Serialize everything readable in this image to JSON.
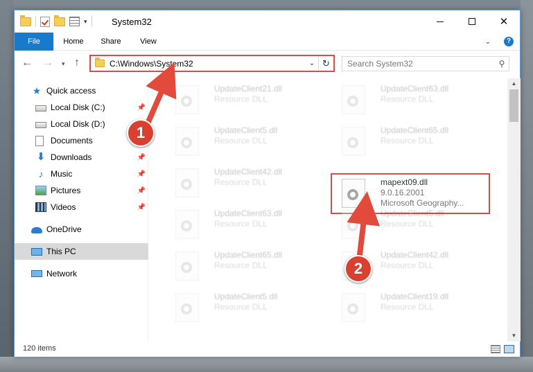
{
  "window": {
    "title": "System32"
  },
  "caption": {
    "minimize_icon": "minimize-icon",
    "maximize_icon": "maximize-icon",
    "close_icon": "close-icon",
    "close_glyph": "✕"
  },
  "ribbon": {
    "tabs": [
      {
        "label": "File",
        "active": true
      },
      {
        "label": "Home"
      },
      {
        "label": "Share"
      },
      {
        "label": "View"
      }
    ],
    "help_glyph": "?"
  },
  "navigation": {
    "back_glyph": "←",
    "forward_glyph": "→",
    "recent_glyph": "▾",
    "up_glyph": "↑",
    "address": "C:\\Windows\\System32",
    "address_dropdown_glyph": "⌄",
    "refresh_glyph": "↻",
    "search_placeholder": "Search System32"
  },
  "sidebar": {
    "items": [
      {
        "label": "Quick access",
        "icon": "star-icon",
        "pinned": false
      },
      {
        "label": "Local Disk (C:)",
        "icon": "disk-icon",
        "pinned": true
      },
      {
        "label": "Local Disk (D:)",
        "icon": "disk-icon",
        "pinned": false
      },
      {
        "label": "Documents",
        "icon": "documents-icon",
        "pinned": true
      },
      {
        "label": "Downloads",
        "icon": "downloads-icon",
        "pinned": true
      },
      {
        "label": "Music",
        "icon": "music-icon",
        "pinned": true
      },
      {
        "label": "Pictures",
        "icon": "pictures-icon",
        "pinned": true
      },
      {
        "label": "Videos",
        "icon": "videos-icon",
        "pinned": true
      },
      {
        "label": "OneDrive",
        "icon": "onedrive-icon",
        "pinned": false
      },
      {
        "label": "This PC",
        "icon": "this-pc-icon",
        "pinned": false,
        "selected": true
      },
      {
        "label": "Network",
        "icon": "network-icon",
        "pinned": false
      }
    ],
    "pin_glyph": "📌"
  },
  "files": {
    "left_column": [
      {
        "name": "UpdateClient21.dll",
        "type": "Resource DLL"
      },
      {
        "name": "UpdateClient5.dll",
        "type": "Resource DLL"
      },
      {
        "name": "UpdateClient42.dll",
        "type": "Resource DLL"
      },
      {
        "name": "UpdateClient63.dll",
        "type": "Resource DLL"
      },
      {
        "name": "UpdateClient65.dll",
        "type": "Resource DLL"
      },
      {
        "name": "UpdateClient5.dll",
        "type": "Resource DLL"
      }
    ],
    "right_column": [
      {
        "name": "UpdateClient63.dll",
        "type": "Resource DLL"
      },
      {
        "name": "UpdateClient65.dll",
        "type": "Resource DLL"
      },
      {
        "name": "mapext09.dll",
        "version": "9.0.16.2001",
        "company": "Microsoft Geography...",
        "highlighted": true
      },
      {
        "name": "UpdateClient5.dll",
        "type": "Resource DLL"
      },
      {
        "name": "UpdateClient42.dll",
        "type": "Resource DLL"
      },
      {
        "name": "UpdateClient19.dll",
        "type": "Resource DLL"
      }
    ]
  },
  "scrollbar": {
    "up_glyph": "▲",
    "down_glyph": "▼"
  },
  "status": {
    "item_count": "120 items"
  },
  "callouts": [
    {
      "number": "1",
      "color": "#d9402f"
    },
    {
      "number": "2",
      "color": "#d9402f"
    }
  ],
  "colors": {
    "accent": "#1979ca",
    "highlight": "#d94a4a"
  }
}
